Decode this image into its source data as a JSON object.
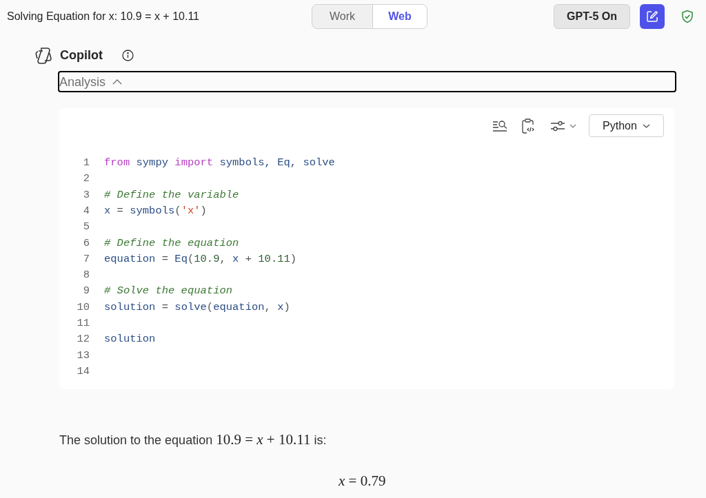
{
  "header": {
    "title": "Solving Equation for x: 10.9 = x + 10.11",
    "modes": [
      {
        "label": "Work",
        "selected": false
      },
      {
        "label": "Web",
        "selected": true
      }
    ],
    "model_button": "GPT-5 On"
  },
  "assistant": {
    "name": "Copilot"
  },
  "analysis": {
    "label": "Analysis",
    "expanded": true
  },
  "code_block": {
    "language": "Python",
    "lines": [
      {
        "number": "1",
        "tokens": [
          {
            "kind": "keyword",
            "text": "from"
          },
          {
            "kind": "name",
            "text": " sympy "
          },
          {
            "kind": "keyword",
            "text": "import"
          },
          {
            "kind": "name",
            "text": " symbols, Eq, solve"
          }
        ]
      },
      {
        "number": "2"
      },
      {
        "number": "3",
        "tokens": [
          {
            "kind": "comment",
            "text": "# Define the variable"
          }
        ]
      },
      {
        "number": "4",
        "tokens": [
          {
            "kind": "name",
            "text": "x"
          },
          {
            "kind": "plain",
            "text": " = "
          },
          {
            "kind": "name",
            "text": "symbols"
          },
          {
            "kind": "plain",
            "text": "("
          },
          {
            "kind": "string",
            "text": "'x'"
          },
          {
            "kind": "plain",
            "text": ")"
          }
        ]
      },
      {
        "number": "5"
      },
      {
        "number": "6",
        "tokens": [
          {
            "kind": "comment",
            "text": "# Define the equation"
          }
        ]
      },
      {
        "number": "7",
        "tokens": [
          {
            "kind": "name",
            "text": "equation"
          },
          {
            "kind": "plain",
            "text": " = "
          },
          {
            "kind": "name",
            "text": "Eq"
          },
          {
            "kind": "plain",
            "text": "("
          },
          {
            "kind": "number",
            "text": "10.9"
          },
          {
            "kind": "plain",
            "text": ", "
          },
          {
            "kind": "name",
            "text": "x"
          },
          {
            "kind": "plain",
            "text": " + "
          },
          {
            "kind": "number",
            "text": "10.11"
          },
          {
            "kind": "plain",
            "text": ")"
          }
        ]
      },
      {
        "number": "8"
      },
      {
        "number": "9",
        "tokens": [
          {
            "kind": "comment",
            "text": "# Solve the equation"
          }
        ]
      },
      {
        "number": "10",
        "tokens": [
          {
            "kind": "name",
            "text": "solution"
          },
          {
            "kind": "plain",
            "text": " = "
          },
          {
            "kind": "name",
            "text": "solve"
          },
          {
            "kind": "plain",
            "text": "("
          },
          {
            "kind": "name",
            "text": "equation"
          },
          {
            "kind": "plain",
            "text": ", "
          },
          {
            "kind": "name",
            "text": "x"
          },
          {
            "kind": "plain",
            "text": ")"
          }
        ]
      },
      {
        "number": "11"
      },
      {
        "number": "12",
        "tokens": [
          {
            "kind": "name",
            "text": "solution"
          }
        ]
      },
      {
        "number": "13"
      },
      {
        "number": "14"
      }
    ]
  },
  "answer": {
    "before": "The solution to the equation ",
    "math": "10.9 = *x* + 10.11",
    "after": " is:",
    "result": "*x* = 0.79"
  }
}
